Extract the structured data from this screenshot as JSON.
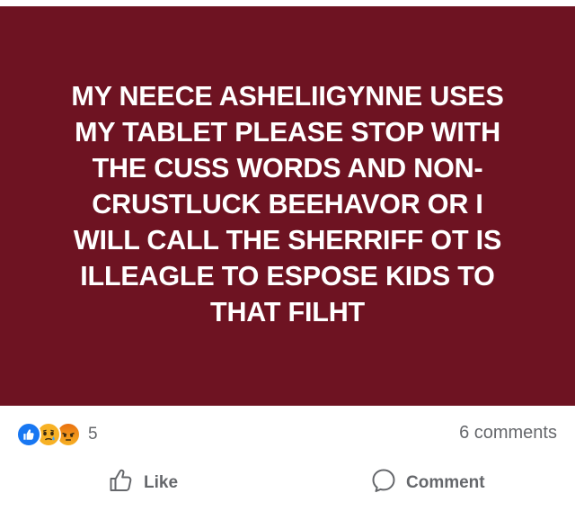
{
  "post": {
    "background_color": "#6e1322",
    "text_color": "#ffffff",
    "lines": [
      "MY NEECE ASHELIIGYNNE USES",
      "MY TABLET PLEASE STOP WITH",
      "THE CUSS WORDS AND NON-",
      "CRUSTLUCK BEEHAVOR OR I",
      "WILL CALL THE SHERRIFF OT IS",
      "ILLEAGLE TO ESPOSE KIDS TO",
      "THAT FILHT"
    ]
  },
  "stats": {
    "reaction_icons": [
      "like-reaction-icon",
      "sad-reaction-icon",
      "angry-reaction-icon"
    ],
    "reaction_count": "5",
    "comments_count": "6 comments"
  },
  "actions": {
    "like_label": "Like",
    "like_icon": "thumbs-up-icon",
    "comment_label": "Comment",
    "comment_icon": "comment-bubble-icon"
  },
  "colors": {
    "secondary_text": "#65676b",
    "like_blue": "#1877f2"
  }
}
